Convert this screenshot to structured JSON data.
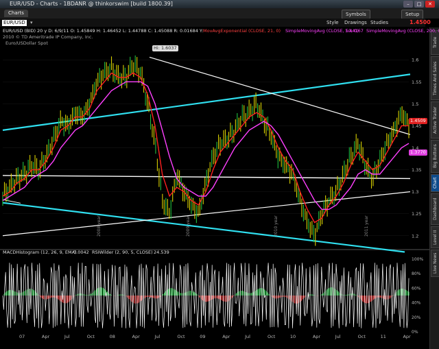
{
  "window": {
    "title": "EUR/USD - Charts - 1BDANR @ thinkorswim [build 1800.39]",
    "tab_label": "Charts",
    "buttons": [
      "Symbols",
      "Setup"
    ]
  },
  "toolbar": {
    "symbol": "EUR/USD",
    "style_label": "Style",
    "drawings_label": "Drawings",
    "studies_label": "Studies",
    "last_price": "1.4500"
  },
  "legend": {
    "quote": "EUR/USD (BID) 20 y D: 6/9/11 O: 1.45849 H: 1.46452 L: 1.44788 C: 1.45088 R: 0.01684 Y:",
    "study1": "MovAvgExponential (CLOSE, 21, 0)",
    "study2": "SimpleMovingAvg (CLOSE, 50, 0)",
    "study2_value": "1.44167",
    "study3": "SimpleMovingAvg (CLOSE, 200, 0)",
    "copyright": "2010 © TD Ameritrade IP Company, Inc.",
    "spot_label": "Euro/USDollar Spot",
    "macd": "MACDHistogram (12, 26, 9, EMA)",
    "macd_value": "0.0042",
    "rsi": "RSIWilder (2, 90, 5, CLOSE)",
    "rsi_value": "24.539"
  },
  "annotations": {
    "high_label": "Hi: 1.6037",
    "price_tag_red": "1.4509",
    "price_tag_white": "1.3770"
  },
  "right_tabs": [
    "Trade",
    "Times And Sales",
    "Active Trader",
    "Big Buttons",
    "Chart",
    "Dashboard",
    "Level II",
    "Live News"
  ],
  "year_marks": [
    "2008 year",
    "2009 year",
    "2010 year",
    "2011 year"
  ],
  "colors": {
    "price": "#d8d000",
    "price_down": "#20c040",
    "ema21": "#ff2020",
    "sma50": "#ff40ff",
    "trend_cyan": "#30e0f0",
    "trend_white": "#ffffff"
  },
  "chart_data": {
    "type": "line",
    "ylim": [
      1.17,
      1.63
    ],
    "y_ticks": [
      1.2,
      1.25,
      1.3,
      1.35,
      1.4,
      1.45,
      1.5,
      1.55,
      1.6
    ],
    "x_labels": [
      "07",
      "Apr",
      "Jul",
      "Oct",
      "08",
      "Apr",
      "Jul",
      "Oct",
      "09",
      "Apr",
      "Jul",
      "Oct",
      "10",
      "Apr",
      "Jul",
      "Oct",
      "11",
      "Apr"
    ],
    "series": [
      {
        "name": "EUR/USD",
        "values": [
          1.29,
          1.31,
          1.33,
          1.34,
          1.36,
          1.35,
          1.38,
          1.42,
          1.46,
          1.45,
          1.48,
          1.47,
          1.5,
          1.55,
          1.57,
          1.58,
          1.56,
          1.56,
          1.59,
          1.57,
          1.5,
          1.41,
          1.28,
          1.25,
          1.34,
          1.3,
          1.27,
          1.25,
          1.32,
          1.38,
          1.41,
          1.42,
          1.44,
          1.47,
          1.48,
          1.5,
          1.46,
          1.43,
          1.38,
          1.36,
          1.34,
          1.28,
          1.23,
          1.2,
          1.25,
          1.28,
          1.3,
          1.34,
          1.38,
          1.41,
          1.36,
          1.33,
          1.37,
          1.41,
          1.44,
          1.48,
          1.45
        ]
      },
      {
        "name": "MovAvgExponential (CLOSE, 21, 0)",
        "values": [
          1.29,
          1.3,
          1.32,
          1.33,
          1.35,
          1.35,
          1.37,
          1.4,
          1.44,
          1.45,
          1.47,
          1.47,
          1.49,
          1.53,
          1.55,
          1.57,
          1.56,
          1.56,
          1.57,
          1.56,
          1.52,
          1.45,
          1.34,
          1.29,
          1.31,
          1.3,
          1.28,
          1.27,
          1.3,
          1.35,
          1.39,
          1.41,
          1.43,
          1.45,
          1.47,
          1.48,
          1.47,
          1.44,
          1.4,
          1.37,
          1.35,
          1.3,
          1.26,
          1.23,
          1.24,
          1.27,
          1.29,
          1.32,
          1.36,
          1.39,
          1.37,
          1.35,
          1.36,
          1.39,
          1.42,
          1.45,
          1.45
        ]
      },
      {
        "name": "SimpleMovingAvg (CLOSE, 50, 0)",
        "values": [
          1.28,
          1.29,
          1.3,
          1.31,
          1.33,
          1.34,
          1.35,
          1.37,
          1.4,
          1.42,
          1.44,
          1.45,
          1.47,
          1.49,
          1.51,
          1.53,
          1.54,
          1.55,
          1.55,
          1.55,
          1.54,
          1.5,
          1.44,
          1.38,
          1.33,
          1.31,
          1.3,
          1.29,
          1.29,
          1.31,
          1.34,
          1.37,
          1.4,
          1.42,
          1.44,
          1.45,
          1.46,
          1.45,
          1.43,
          1.4,
          1.37,
          1.34,
          1.31,
          1.28,
          1.26,
          1.26,
          1.27,
          1.29,
          1.31,
          1.34,
          1.35,
          1.34,
          1.34,
          1.36,
          1.38,
          1.4,
          1.41
        ]
      }
    ],
    "lower_panel": {
      "rsi_levels": [
        "100%",
        "80%",
        "60%",
        "40%",
        "20%",
        "0%"
      ]
    }
  }
}
